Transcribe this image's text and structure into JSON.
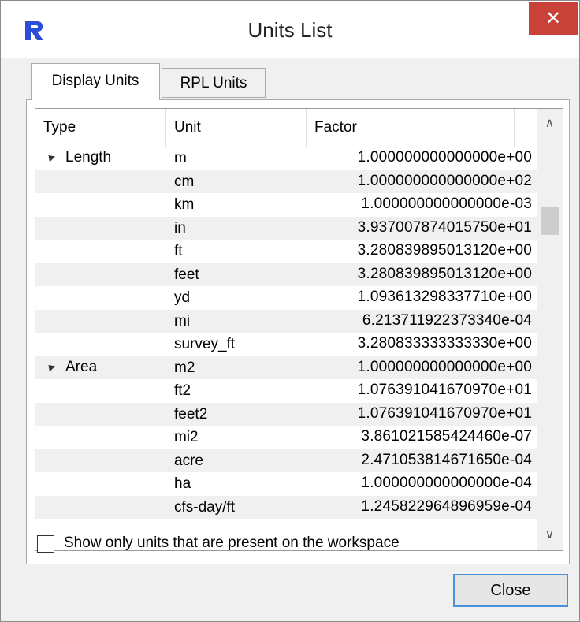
{
  "window": {
    "title": "Units List",
    "close_symbol": "✕"
  },
  "tabs": [
    {
      "label": "Display Units",
      "active": true
    },
    {
      "label": "RPL Units",
      "active": false
    }
  ],
  "table": {
    "columns": [
      "Type",
      "Unit",
      "Factor"
    ],
    "rows": [
      {
        "type": "Length",
        "unit": "m",
        "factor": "1.000000000000000e+00"
      },
      {
        "type": "",
        "unit": "cm",
        "factor": "1.000000000000000e+02"
      },
      {
        "type": "",
        "unit": "km",
        "factor": "1.000000000000000e-03"
      },
      {
        "type": "",
        "unit": "in",
        "factor": "3.937007874015750e+01"
      },
      {
        "type": "",
        "unit": "ft",
        "factor": "3.280839895013120e+00"
      },
      {
        "type": "",
        "unit": "feet",
        "factor": "3.280839895013120e+00"
      },
      {
        "type": "",
        "unit": "yd",
        "factor": "1.093613298337710e+00"
      },
      {
        "type": "",
        "unit": "mi",
        "factor": "6.213711922373340e-04"
      },
      {
        "type": "",
        "unit": "survey_ft",
        "factor": "3.280833333333330e+00"
      },
      {
        "type": "Area",
        "unit": "m2",
        "factor": "1.000000000000000e+00"
      },
      {
        "type": "",
        "unit": "ft2",
        "factor": "1.076391041670970e+01"
      },
      {
        "type": "",
        "unit": "feet2",
        "factor": "1.076391041670970e+01"
      },
      {
        "type": "",
        "unit": "mi2",
        "factor": "3.861021585424460e-07"
      },
      {
        "type": "",
        "unit": "acre",
        "factor": "2.471053814671650e-04"
      },
      {
        "type": "",
        "unit": "ha",
        "factor": "1.000000000000000e-04"
      },
      {
        "type": "",
        "unit": "cfs-day/ft",
        "factor": "1.245822964896959e-04"
      }
    ]
  },
  "filter": {
    "checkbox_label": "Show only units that are present on the workspace",
    "checked": false
  },
  "buttons": {
    "close_label": "Close"
  },
  "colors": {
    "close_hover": "#c8423a",
    "app_icon_blue": "#2a4fd6",
    "focus_border": "#4a90d9"
  }
}
